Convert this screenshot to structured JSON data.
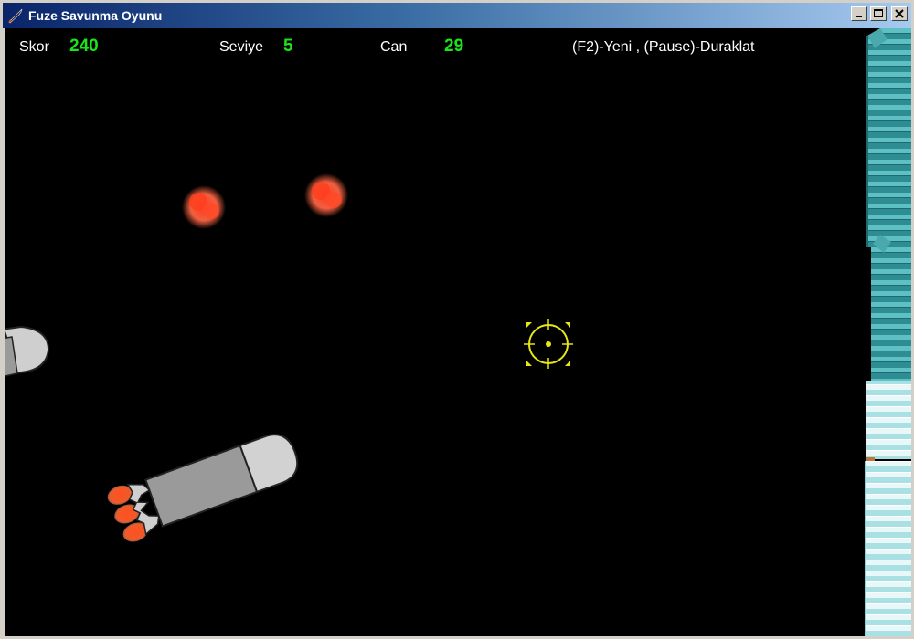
{
  "window": {
    "title": "Fuze Savunma Oyunu"
  },
  "hud": {
    "score": {
      "label": "Skor",
      "value": "240"
    },
    "level": {
      "label": "Seviye",
      "value": "5"
    },
    "lives": {
      "label": "Can",
      "value": "29"
    },
    "controls_hint": "(F2)-Yeni , (Pause)-Duraklat"
  },
  "colors": {
    "background": "#000000",
    "hud_value": "#19e619",
    "crosshair": "#e6e619",
    "missile_body": "#9a9a9a",
    "missile_nose": "#d2d2d2",
    "flame": "#f0501e",
    "building": "#3a9fa0"
  },
  "icons": {
    "app": "rocket-icon",
    "minimize": "minimize-icon",
    "maximize": "maximize-icon",
    "close": "close-icon",
    "crosshair": "crosshair-icon"
  }
}
